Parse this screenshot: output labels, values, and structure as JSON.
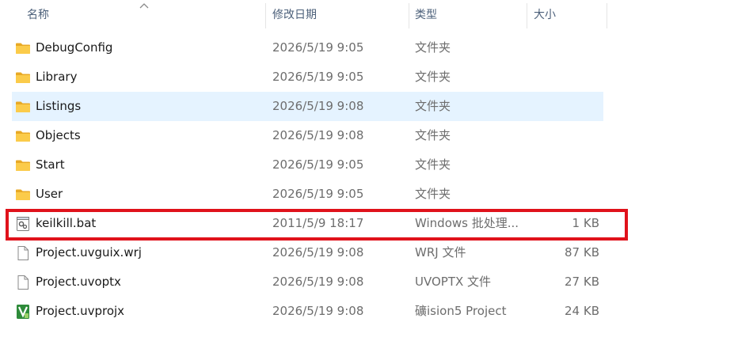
{
  "header": {
    "name": "名称",
    "date": "修改日期",
    "type": "类型",
    "size": "大小",
    "sort_icon": "chevron-up-icon"
  },
  "files": [
    {
      "name": "DebugConfig",
      "date": "2026/5/19 9:05",
      "type": "文件夹",
      "size": "",
      "icon": "folder-icon"
    },
    {
      "name": "Library",
      "date": "2026/5/19 9:05",
      "type": "文件夹",
      "size": "",
      "icon": "folder-icon"
    },
    {
      "name": "Listings",
      "date": "2026/5/19 9:08",
      "type": "文件夹",
      "size": "",
      "icon": "folder-icon",
      "selected": true
    },
    {
      "name": "Objects",
      "date": "2026/5/19 9:08",
      "type": "文件夹",
      "size": "",
      "icon": "folder-icon"
    },
    {
      "name": "Start",
      "date": "2026/5/19 9:05",
      "type": "文件夹",
      "size": "",
      "icon": "folder-icon"
    },
    {
      "name": "User",
      "date": "2026/5/19 9:05",
      "type": "文件夹",
      "size": "",
      "icon": "folder-icon"
    },
    {
      "name": "keilkill.bat",
      "date": "2011/5/9 18:17",
      "type": "Windows 批处理...",
      "size": "1 KB",
      "icon": "batch-file-icon",
      "highlighted": true
    },
    {
      "name": "Project.uvguix.wrj",
      "date": "2026/5/19 9:08",
      "type": "WRJ 文件",
      "size": "87 KB",
      "icon": "file-icon"
    },
    {
      "name": "Project.uvoptx",
      "date": "2026/5/19 9:08",
      "type": "UVOPTX 文件",
      "size": "27 KB",
      "icon": "file-icon"
    },
    {
      "name": "Project.uvprojx",
      "date": "2026/5/19 9:08",
      "type": "礦ision5 Project",
      "size": "24 KB",
      "icon": "uvision-project-icon"
    }
  ],
  "colors": {
    "selection": "#e5f3ff",
    "highlight_border": "#e0121b",
    "folder": "#f8c53a"
  }
}
